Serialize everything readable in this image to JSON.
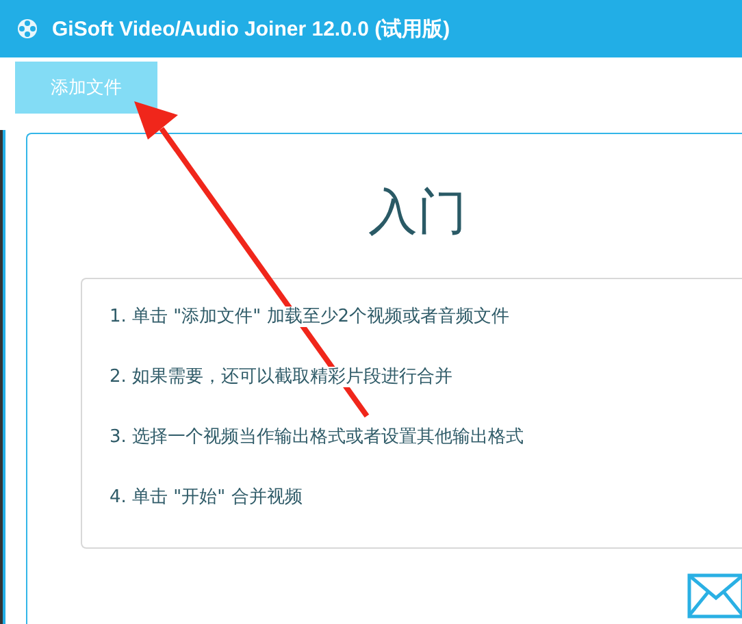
{
  "window": {
    "title": "GiSoft Video/Audio Joiner 12.0.0 (试用版)"
  },
  "toolbar": {
    "add_button": "添加文件"
  },
  "guide": {
    "title": "入门",
    "steps": [
      "1. 单击 \"添加文件\" 加载至少2个视频或者音频文件",
      "2. 如果需要，还可以截取精彩片段进行合并",
      "3. 选择一个视频当作输出格式或者设置其他输出格式",
      "4. 单击 \"开始\" 合并视频"
    ]
  }
}
